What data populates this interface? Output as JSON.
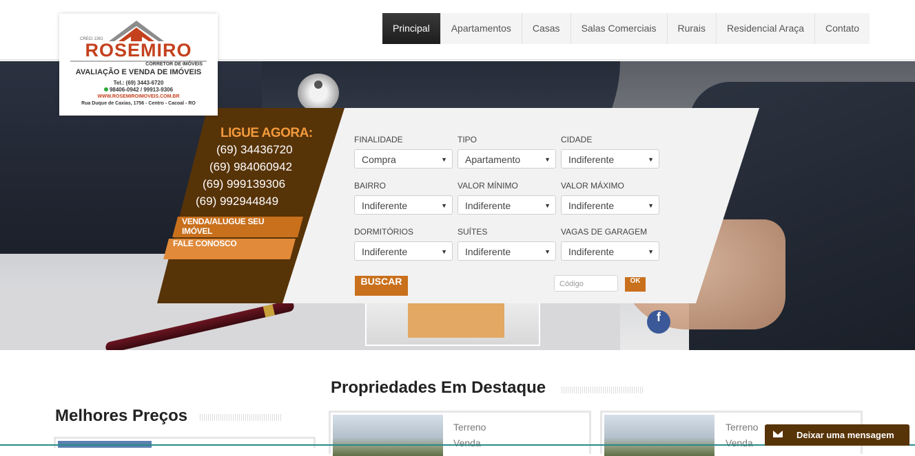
{
  "logo": {
    "creci": "CRECI 1391",
    "name": "ROSEMIRO",
    "subtitle": "CORRETOR DE IMÓVEIS",
    "tagline": "AVALIAÇÃO E VENDA DE IMÓVEIS",
    "tel": "Tel.: (69) 3443-6720",
    "cell": "98406-0942 / 99913-9306",
    "website": "WWW.ROSEMIROIMOVEIS.COM.BR",
    "address": "Rua Duque de Caxias, 1756 - Centro - Cacoal - RO"
  },
  "nav": {
    "items": [
      "Principal",
      "Apartamentos",
      "Casas",
      "Salas Comerciais",
      "Rurais",
      "Residencial Araça",
      "Contato"
    ],
    "active": "Principal"
  },
  "contact": {
    "heading": "LIGUE AGORA:",
    "phones": [
      "(69) 34436720",
      "(69) 984060942",
      "(69) 999139306",
      "(69) 992944849"
    ],
    "buttons": [
      "VENDA/ALUGUE SEU IMÓVEL",
      "FALE CONOSCO"
    ]
  },
  "search": {
    "fields": [
      {
        "label": "FINALIDADE",
        "value": "Compra"
      },
      {
        "label": "TIPO",
        "value": "Apartamento"
      },
      {
        "label": "CIDADE",
        "value": "Indiferente"
      },
      {
        "label": "BAIRRO",
        "value": "Indiferente"
      },
      {
        "label": "VALOR MÍNIMO",
        "value": "Indiferente"
      },
      {
        "label": "VALOR MÁXIMO",
        "value": "Indiferente"
      },
      {
        "label": "DORMITÓRIOS",
        "value": "Indiferente"
      },
      {
        "label": "SUÍTES",
        "value": "Indiferente"
      },
      {
        "label": "VAGAS DE GARAGEM",
        "value": "Indiferente"
      }
    ],
    "button": "BUSCAR",
    "code_placeholder": "Código",
    "code_button": "OK"
  },
  "social": {
    "facebook": "f"
  },
  "sections": {
    "featured_title": "Propriedades Em Destaque",
    "best_prices_title": "Melhores Preços"
  },
  "featured": [
    {
      "type": "Terreno",
      "status": "Venda"
    },
    {
      "type": "Terreno",
      "status": "Venda"
    }
  ],
  "chat": {
    "label": "Deixar uma mensagem"
  },
  "colors": {
    "brown": "#573308",
    "orange": "#c9701d",
    "accent_orange": "#f39a3c",
    "facebook": "#3b5998"
  }
}
